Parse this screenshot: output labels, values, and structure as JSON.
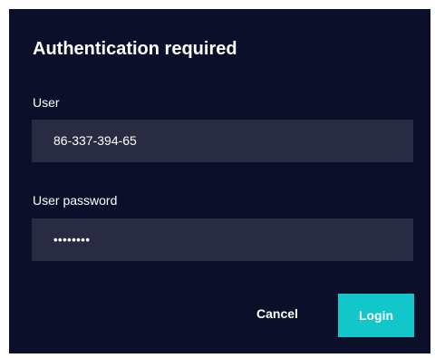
{
  "dialog": {
    "title": "Authentication required",
    "user": {
      "label": "User",
      "value": "86-337-394-65"
    },
    "password": {
      "label": "User password",
      "value": "••••••••"
    },
    "actions": {
      "cancel_label": "Cancel",
      "login_label": "Login"
    }
  },
  "colors": {
    "dialog_background": "#0b0f2a",
    "field_background": "#292b42",
    "accent": "#12c7c9",
    "text": "#ffffff"
  }
}
